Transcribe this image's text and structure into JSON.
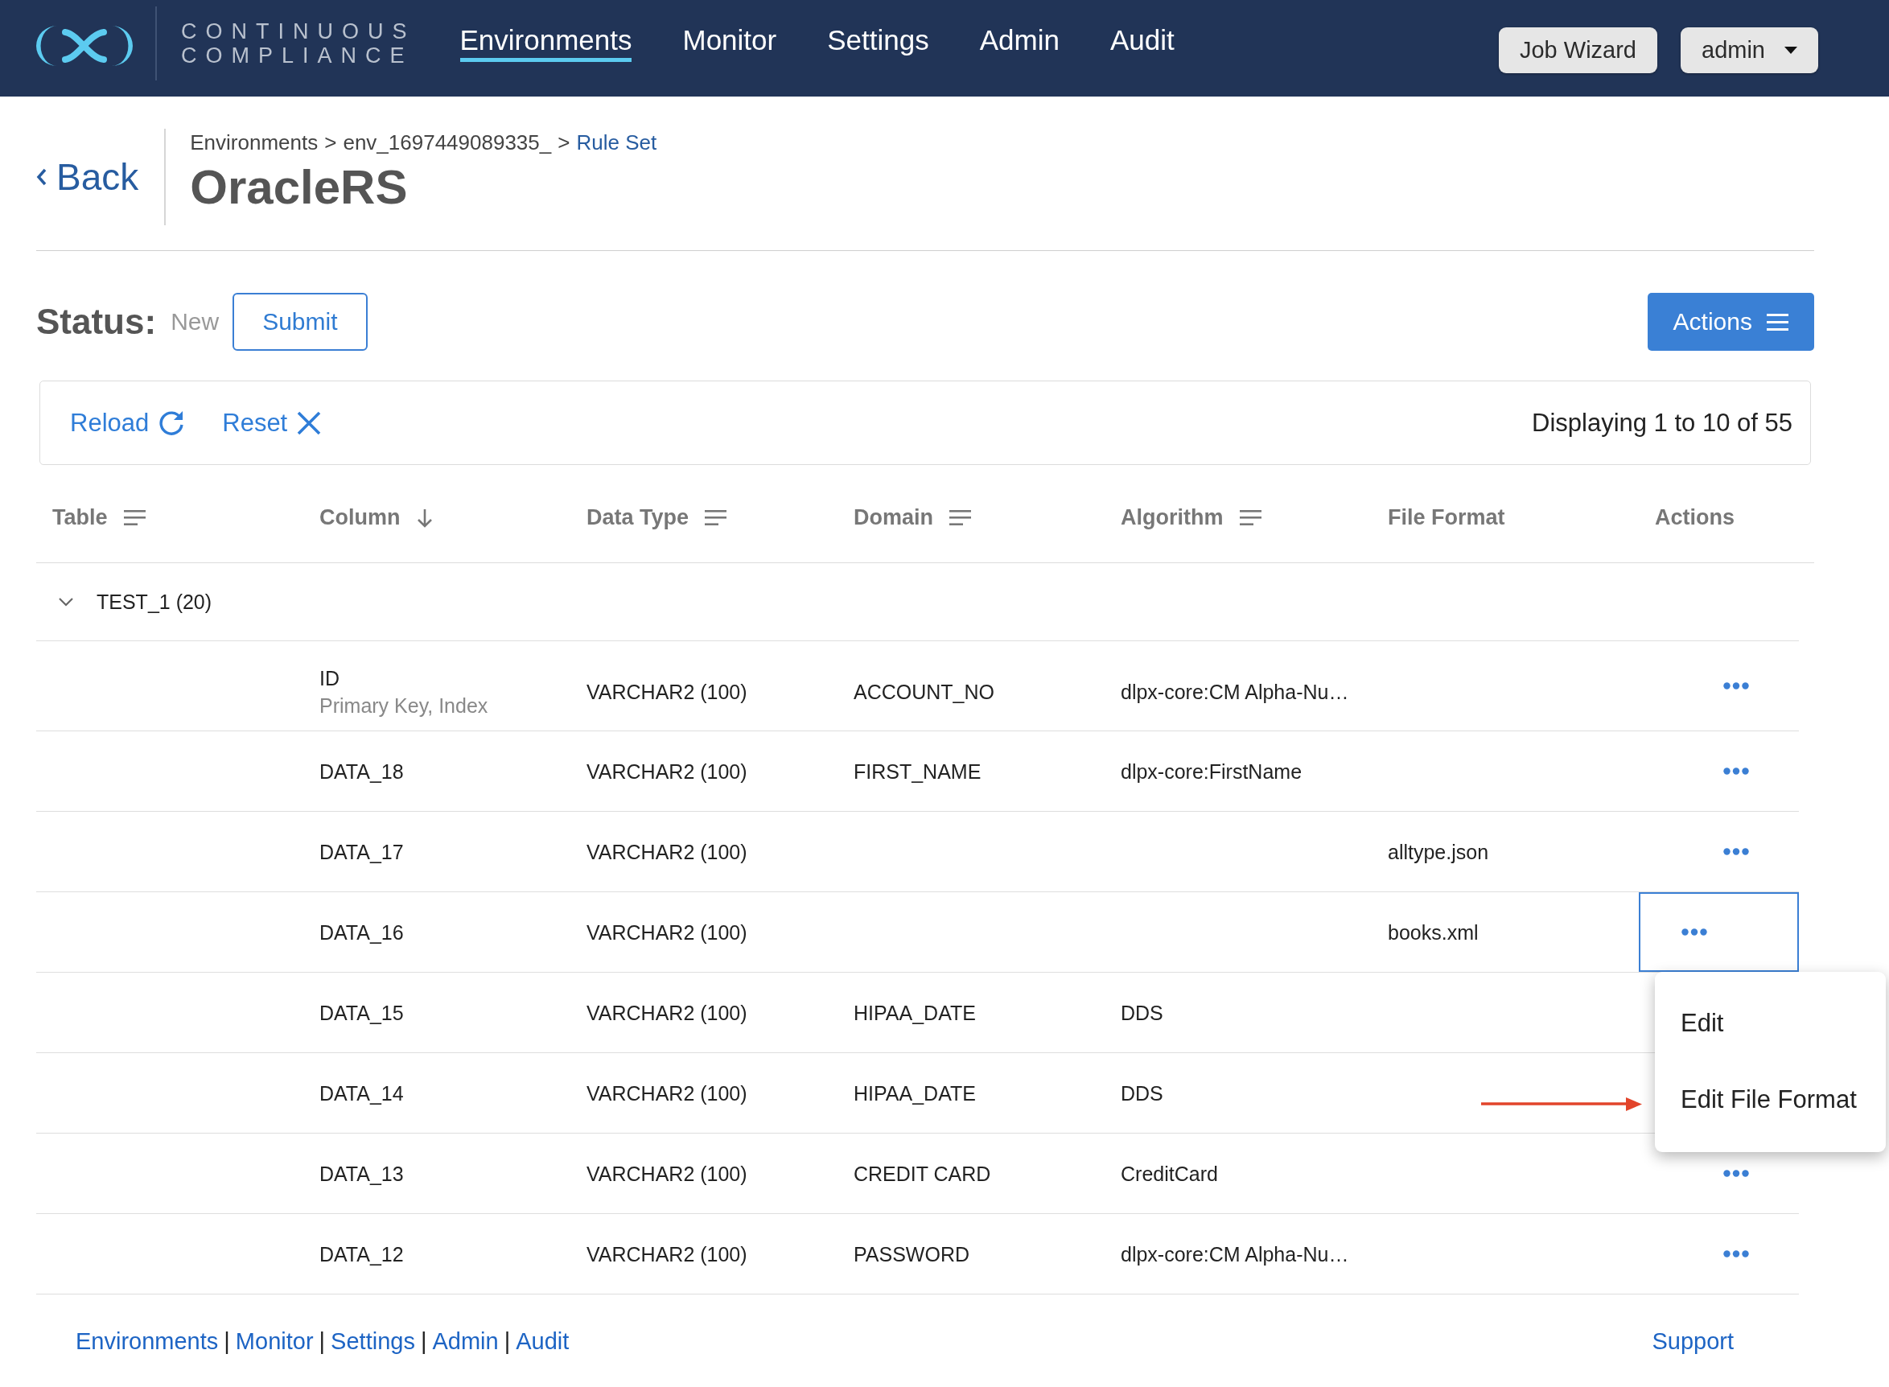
{
  "header": {
    "brand": {
      "line_1": "CONTINUOUS",
      "line_2": "COMPLIANCE"
    },
    "nav": [
      {
        "label": "Environments",
        "selected": true
      },
      {
        "label": "Monitor",
        "selected": false
      },
      {
        "label": "Settings",
        "selected": false
      },
      {
        "label": "Admin",
        "selected": false
      },
      {
        "label": "Audit",
        "selected": false
      }
    ],
    "job_wizard_button": "Job Wizard",
    "user_menu": "admin"
  },
  "page_header": {
    "back_link": "Back",
    "breadcrumb": [
      {
        "kind": "crumb",
        "label": "Environments"
      },
      {
        "kind": "separator",
        "label": ">"
      },
      {
        "kind": "crumb",
        "label": "env_1697449089335_"
      },
      {
        "kind": "separator",
        "label": ">"
      },
      {
        "kind": "link",
        "label": "Rule Set"
      }
    ],
    "title": "OracleRS"
  },
  "status": {
    "label": "Status:",
    "value": "New",
    "submit_button": "Submit"
  },
  "actions_button": "Actions",
  "toolbar": {
    "reload_button": "Reload",
    "reset_button": "Reset",
    "summary": "Displaying 1 to 10 of 55"
  },
  "table": {
    "columns": [
      {
        "label": "Table",
        "kind": "filterable"
      },
      {
        "label": "Column",
        "kind": "sorted"
      },
      {
        "label": "Data Type",
        "kind": "filterable"
      },
      {
        "label": "Domain",
        "kind": "filterable"
      },
      {
        "label": "Algorithm",
        "kind": "filterable"
      },
      {
        "label": "File Format",
        "kind": "plain"
      },
      {
        "label": "Actions",
        "kind": "plain"
      }
    ],
    "group": {
      "label": "TEST_1 (20)",
      "expanded": true
    },
    "rows": [
      {
        "column": "ID",
        "column_note": "Primary Key, Index",
        "data_type": "VARCHAR2 (100)",
        "domain": "ACCOUNT_NO",
        "algorithm": "dlpx-core:CM Alpha-Nu…",
        "menu_open": false
      },
      {
        "column": "DATA_18",
        "data_type": "VARCHAR2 (100)",
        "domain": "FIRST_NAME",
        "algorithm": "dlpx-core:FirstName",
        "menu_open": false
      },
      {
        "column": "DATA_17",
        "data_type": "VARCHAR2 (100)",
        "file_format": "alltype.json",
        "menu_open": false
      },
      {
        "column": "DATA_16",
        "data_type": "VARCHAR2 (100)",
        "file_format": "books.xml",
        "menu_open": true
      },
      {
        "column": "DATA_15",
        "data_type": "VARCHAR2 (100)",
        "domain": "HIPAA_DATE",
        "algorithm": "DDS",
        "menu_open": false
      },
      {
        "column": "DATA_14",
        "data_type": "VARCHAR2 (100)",
        "domain": "HIPAA_DATE",
        "algorithm": "DDS",
        "menu_open": false
      },
      {
        "column": "DATA_13",
        "data_type": "VARCHAR2 (100)",
        "domain": "CREDIT CARD",
        "algorithm": "CreditCard",
        "menu_open": false
      },
      {
        "column": "DATA_12",
        "data_type": "VARCHAR2 (100)",
        "domain": "PASSWORD",
        "algorithm": "dlpx-core:CM Alpha-Nu…",
        "menu_open": false
      }
    ],
    "row_menu": {
      "items": [
        {
          "label": "Edit",
          "pointed_at": false
        },
        {
          "label": "Edit File Format",
          "pointed_at": true
        }
      ]
    }
  },
  "footer": {
    "links": [
      {
        "kind": "link",
        "label": "Environments"
      },
      {
        "kind": "separator",
        "label": "|"
      },
      {
        "kind": "link",
        "label": "Monitor"
      },
      {
        "kind": "separator",
        "label": "|"
      },
      {
        "kind": "link",
        "label": "Settings"
      },
      {
        "kind": "separator",
        "label": "|"
      },
      {
        "kind": "link",
        "label": "Admin"
      },
      {
        "kind": "separator",
        "label": "|"
      },
      {
        "kind": "link",
        "label": "Audit"
      }
    ],
    "support_link": "Support"
  }
}
